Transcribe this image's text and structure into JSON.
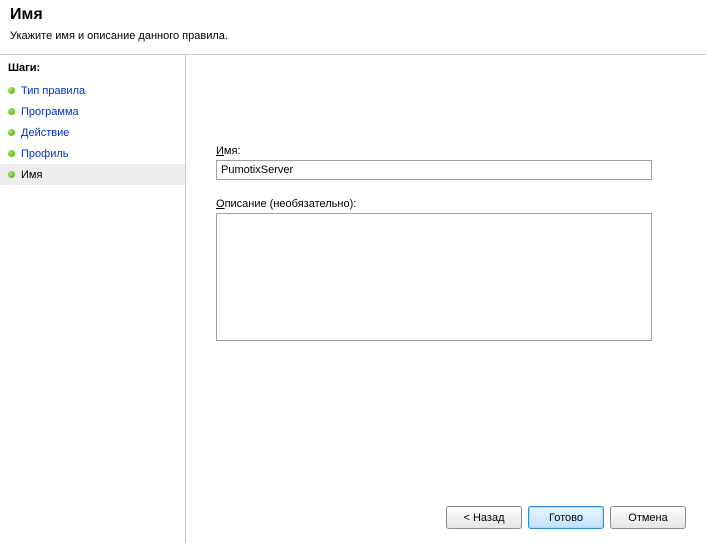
{
  "header": {
    "title": "Имя",
    "subtitle": "Укажите имя и описание данного правила."
  },
  "sidebar": {
    "header": "Шаги:",
    "steps": [
      {
        "label": "Тип правила"
      },
      {
        "label": "Программа"
      },
      {
        "label": "Действие"
      },
      {
        "label": "Профиль"
      },
      {
        "label": "Имя"
      }
    ]
  },
  "form": {
    "name_label_pre": "",
    "name_label_ul": "И",
    "name_label_post": "мя:",
    "name_value": "PumotixServer",
    "desc_label_pre": "",
    "desc_label_ul": "О",
    "desc_label_post": "писание (необязательно):",
    "desc_value": ""
  },
  "buttons": {
    "back": "< Назад",
    "finish": "Готово",
    "cancel": "Отмена"
  }
}
